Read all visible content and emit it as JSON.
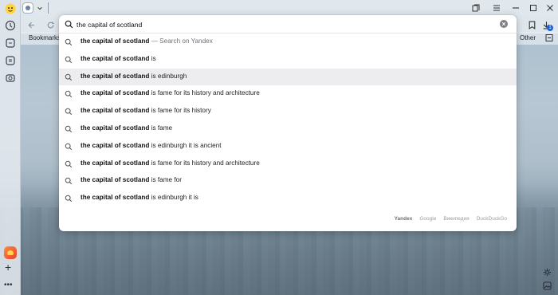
{
  "search": {
    "query": "the capital of scotland"
  },
  "suggestions": [
    {
      "bold": "the capital of scotland",
      "rest": "",
      "note": " — Search on Yandex",
      "active": false
    },
    {
      "bold": "the capital of scotland",
      "rest": " is",
      "note": "",
      "active": false
    },
    {
      "bold": "the capital of scotland",
      "rest": " is edinburgh",
      "note": "",
      "active": true
    },
    {
      "bold": "the capital of scotland",
      "rest": " is fame for its history and architecture",
      "note": "",
      "active": false
    },
    {
      "bold": "the capital of scotland",
      "rest": " is fame for its history",
      "note": "",
      "active": false
    },
    {
      "bold": "the capital of scotland",
      "rest": " is fame",
      "note": "",
      "active": false
    },
    {
      "bold": "the capital of scotland",
      "rest": " is edinburgh it is ancient",
      "note": "",
      "active": false
    },
    {
      "bold": "the capital of scotland",
      "rest": " is fame for its history and architecture",
      "note": "",
      "active": false
    },
    {
      "bold": "the capital of scotland",
      "rest": " is fame for",
      "note": "",
      "active": false
    },
    {
      "bold": "the capital of scotland",
      "rest": " is edinburgh it is",
      "note": "",
      "active": false
    }
  ],
  "engines": [
    "Yandex",
    "Google",
    "Википедия",
    "DuckDuckGo"
  ],
  "bookmarks": {
    "label": "Bookmarks",
    "other": "Other"
  },
  "badge_count": "1",
  "colors": {
    "active_row": "#ededf0",
    "accent": "#1e63d6"
  }
}
